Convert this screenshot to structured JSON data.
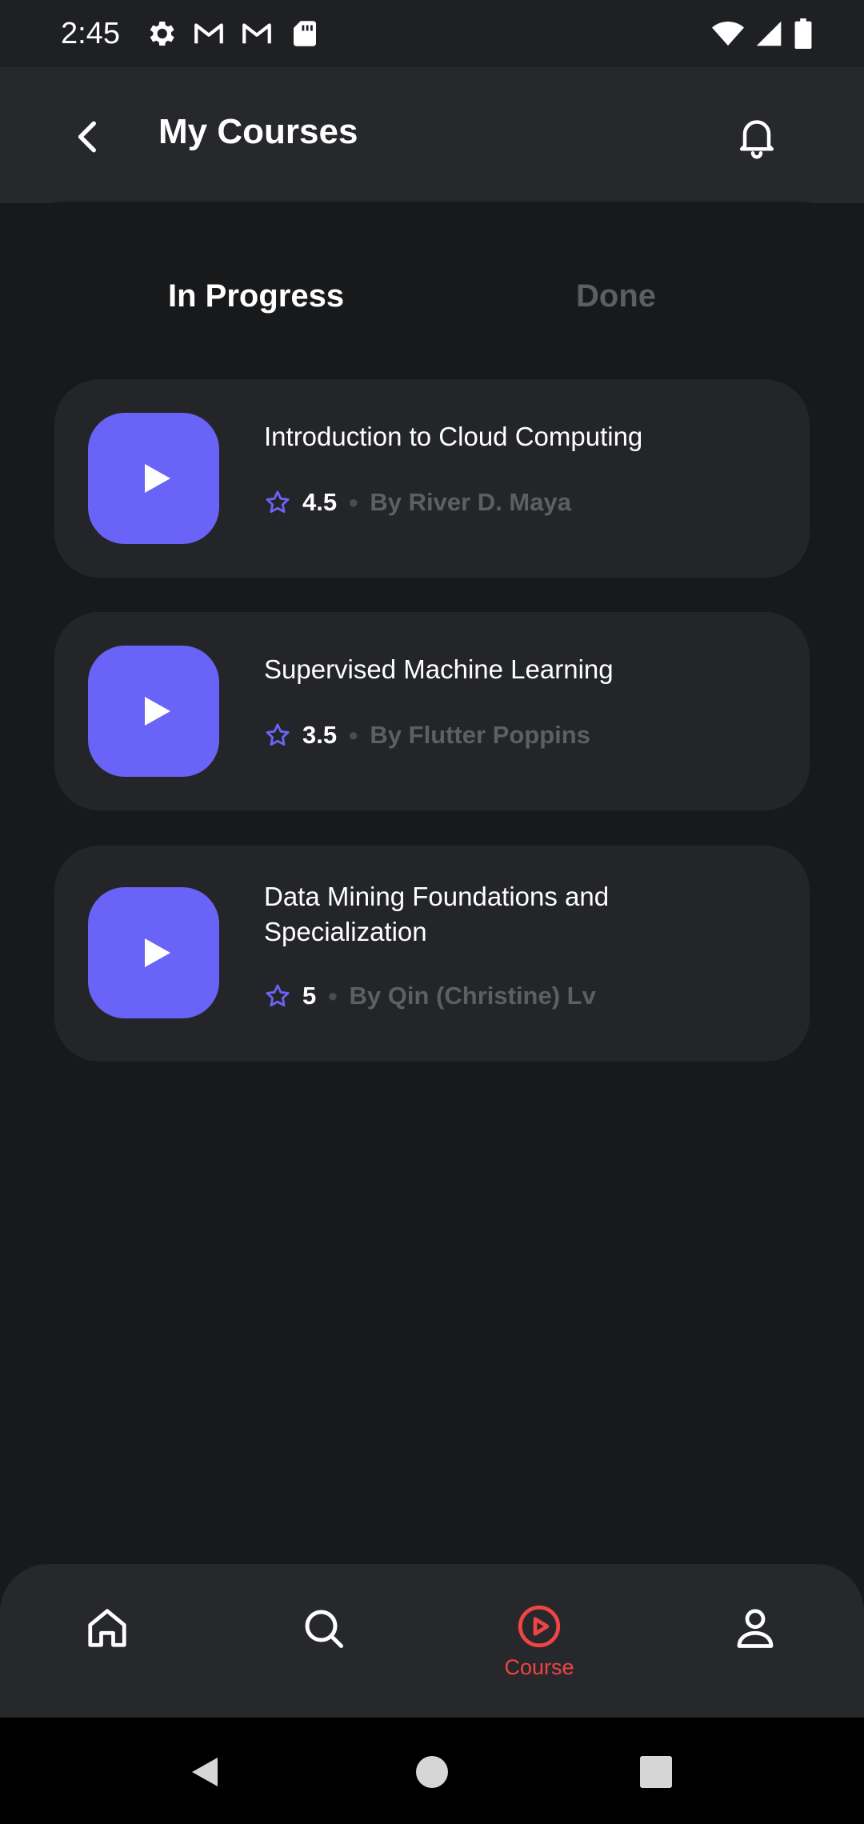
{
  "status_bar": {
    "time": "2:45",
    "left_icons": [
      "settings-icon",
      "gmail-icon",
      "gmail-icon",
      "sd-card-icon"
    ],
    "right_icons": [
      "wifi-icon",
      "signal-icon",
      "battery-icon"
    ]
  },
  "app_bar": {
    "title": "My Courses",
    "back_icon": "chevron-left-icon",
    "notification_icon": "bell-icon"
  },
  "tabs": [
    {
      "label": "In Progress",
      "active": true
    },
    {
      "label": "Done",
      "active": false
    }
  ],
  "courses": [
    {
      "title": "Introduction to Cloud Computing",
      "rating": "4.5",
      "author": "By River D. Maya"
    },
    {
      "title": "Supervised Machine Learning",
      "rating": "3.5",
      "author": "By Flutter Poppins"
    },
    {
      "title": "Data Mining Foundations and Specialization",
      "rating": "5",
      "author": "By Qin (Christine) Lv"
    }
  ],
  "bottom_nav": [
    {
      "icon": "home-icon",
      "label": "",
      "active": false
    },
    {
      "icon": "search-icon",
      "label": "",
      "active": false
    },
    {
      "icon": "play-circle-icon",
      "label": "Course",
      "active": true
    },
    {
      "icon": "profile-icon",
      "label": "",
      "active": false
    }
  ],
  "colors": {
    "accent": "#6a63f7",
    "active_nav": "#ef4444",
    "background": "#18191b",
    "card": "#242528",
    "muted_text": "#5e5f63"
  }
}
